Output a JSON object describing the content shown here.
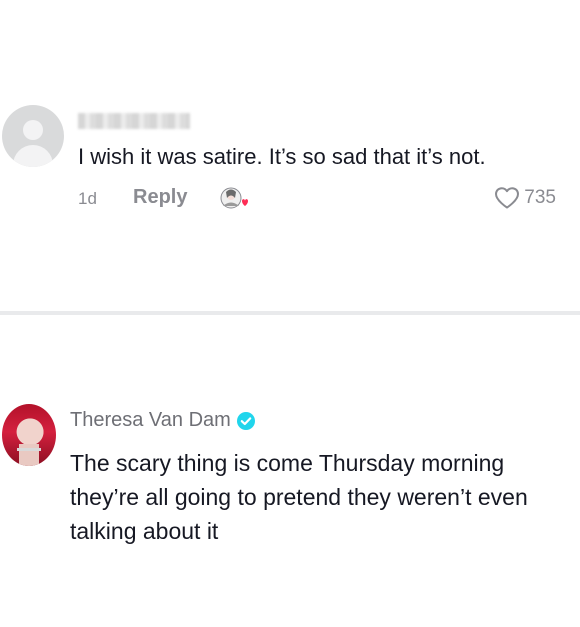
{
  "comment1": {
    "text": "I wish it was satire. It’s so sad that it’s not.",
    "time": "1d",
    "reply_label": "Reply",
    "likes": "735"
  },
  "comment2": {
    "username": "Theresa Van Dam",
    "verified": true,
    "text": "The scary thing is come Thursday morning they’re all going to pretend they weren’t even talking about it"
  },
  "colors": {
    "text_primary": "#161823",
    "text_secondary": "#8a8b91",
    "verified_badge": "#20d5ec",
    "like_heart_badge": "#fe2c55"
  },
  "icons": {
    "like": "heart-outline-icon",
    "verified": "verified-check-icon",
    "creator_like": "creator-liked-heart-icon"
  }
}
